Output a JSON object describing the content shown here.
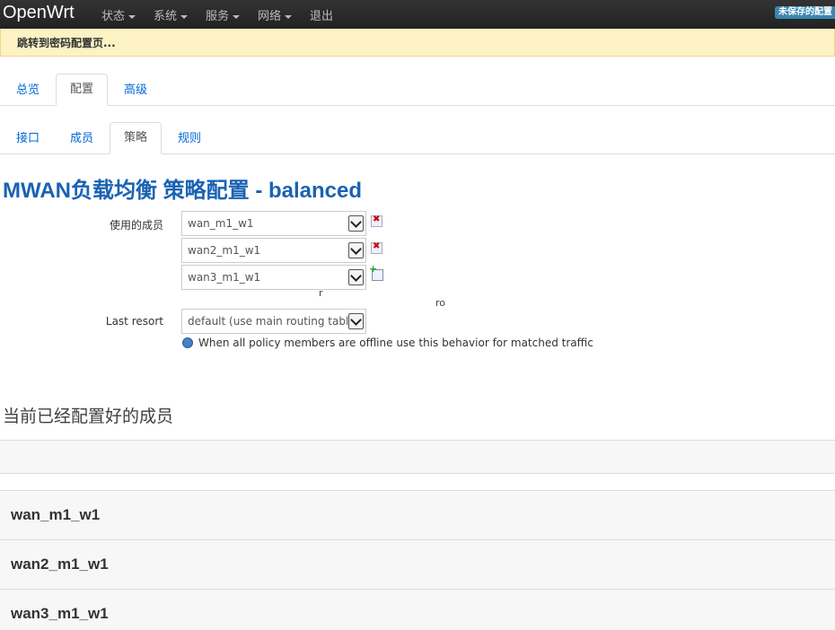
{
  "navbar": {
    "brand": "OpenWrt",
    "menus": [
      "状态",
      "系统",
      "服务",
      "网络"
    ],
    "logout": "退出",
    "unsaved_badge": "未保存的配置"
  },
  "alert": {
    "text": "跳转到密码配置页..."
  },
  "tabs_main": [
    {
      "label": "总览",
      "active": false
    },
    {
      "label": "配置",
      "active": true
    },
    {
      "label": "高级",
      "active": false
    }
  ],
  "tabs_sub": [
    {
      "label": "接口",
      "active": false
    },
    {
      "label": "成员",
      "active": false
    },
    {
      "label": "策略",
      "active": true
    },
    {
      "label": "规则",
      "active": false
    }
  ],
  "page_title": "MWAN负载均衡 策略配置 - balanced",
  "form": {
    "members_label": "使用的成员",
    "members": [
      "wan_m1_w1",
      "wan2_m1_w1",
      "wan3_m1_w1"
    ],
    "last_resort_label": "Last resort",
    "last_resort_value": "default (use main routing table)",
    "help_text": "When all policy members are offline use this behavior for matched traffic",
    "artifact_text_1": "r",
    "artifact_text_2": "ro"
  },
  "members_section": {
    "title": "当前已经配置好的成员",
    "rows": [
      "wan_m1_w1",
      "wan2_m1_w1",
      "wan3_m1_w1"
    ]
  }
}
